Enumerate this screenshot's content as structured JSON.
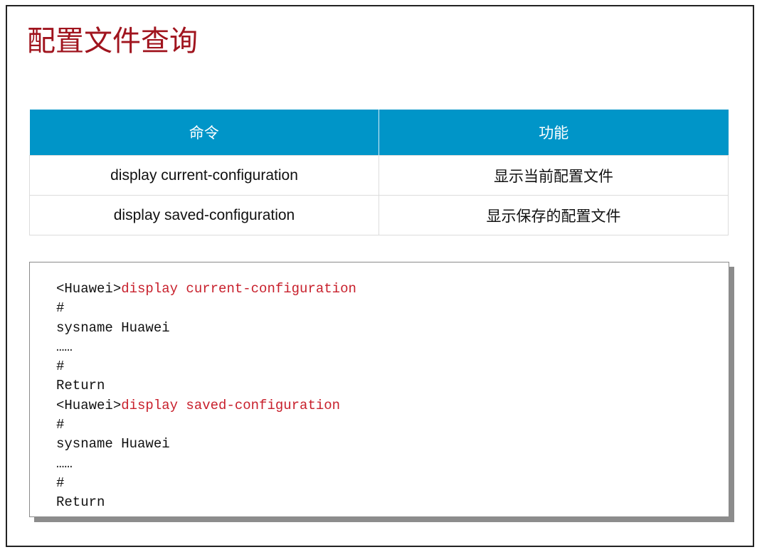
{
  "title": "配置文件查询",
  "table": {
    "headers": [
      "命令",
      "功能"
    ],
    "rows": [
      [
        "display current-configuration",
        "显示当前配置文件"
      ],
      [
        "display saved-configuration",
        "显示保存的配置文件"
      ]
    ]
  },
  "code": {
    "lines": [
      {
        "prompt": "<Huawei>",
        "cmd": "display current-configuration",
        "text": ""
      },
      {
        "prompt": "",
        "cmd": "",
        "text": "#"
      },
      {
        "prompt": "",
        "cmd": "",
        "text": "sysname Huawei"
      },
      {
        "prompt": "",
        "cmd": "",
        "text": "……"
      },
      {
        "prompt": "",
        "cmd": "",
        "text": "#"
      },
      {
        "prompt": "",
        "cmd": "",
        "text": "Return"
      },
      {
        "prompt": "<Huawei>",
        "cmd": "display saved-configuration",
        "text": ""
      },
      {
        "prompt": "",
        "cmd": "",
        "text": "#"
      },
      {
        "prompt": "",
        "cmd": "",
        "text": "sysname Huawei"
      },
      {
        "prompt": "",
        "cmd": "",
        "text": "……"
      },
      {
        "prompt": "",
        "cmd": "",
        "text": "#"
      },
      {
        "prompt": "",
        "cmd": "",
        "text": "Return"
      }
    ]
  },
  "colors": {
    "title": "#a0141e",
    "header_bg": "#0095c8",
    "command_highlight": "#c8202c"
  }
}
